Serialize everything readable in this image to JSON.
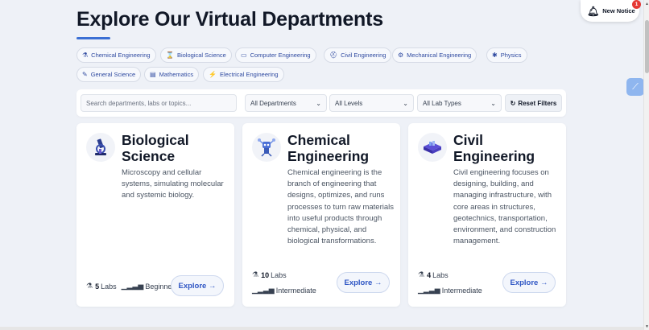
{
  "header": {
    "title": "Explore Our Virtual Departments"
  },
  "chips": [
    {
      "icon": "flask-icon",
      "glyph": "⚗",
      "label": "Chemical Engineering"
    },
    {
      "icon": "dna-icon",
      "glyph": "⌛",
      "label": "Biological Science"
    },
    {
      "icon": "laptop-icon",
      "glyph": "▭",
      "label": "Computer Engineering"
    },
    {
      "icon": "hardhat-icon",
      "glyph": "⛑",
      "label": "Civil Engineering"
    },
    {
      "icon": "gears-icon",
      "glyph": "⚙",
      "label": "Mechanical Engineering"
    },
    {
      "icon": "atom-icon",
      "glyph": "✱",
      "label": "Physics"
    },
    {
      "icon": "pen-icon",
      "glyph": "✎",
      "label": "General Science"
    },
    {
      "icon": "calculator-icon",
      "glyph": "▤",
      "label": "Mathematics"
    },
    {
      "icon": "bolt-icon",
      "glyph": "⚡",
      "label": "Electrical Engineering"
    }
  ],
  "filters": {
    "search_placeholder": "Search departments, labs or topics...",
    "department": "All Departments",
    "level": "All Levels",
    "lab_type": "All Lab Types",
    "reset_label": "Reset Filters"
  },
  "cards": [
    {
      "title": "Biological Science",
      "description": "Microscopy and cellular systems, simulating molecular and systemic biology.",
      "labs_count": "5",
      "labs_label": "Labs",
      "level": "Beginner",
      "explore_label": "Explore →"
    },
    {
      "title": "Chemical Engineering",
      "description": "Chemical engineering is the branch of engineering that designs, optimizes, and runs processes to turn raw materials into useful products through chemical, physical, and biological transformations.",
      "labs_count": "10",
      "labs_label": "Labs",
      "level": "Intermediate",
      "explore_label": "Explore →"
    },
    {
      "title": "Civil Engineering",
      "description": "Civil engineering focuses on designing, building, and managing infrastructure, with core areas in structures, geotechnics, transportation, environment, and construction management.",
      "labs_count": "4",
      "labs_label": "Labs",
      "level": "Intermediate",
      "explore_label": "Explore →"
    }
  ],
  "notice": {
    "label": "New Notice",
    "count": "1"
  },
  "colors": {
    "accent": "#2f56c4",
    "background": "#eef1f7",
    "badge": "#e53935"
  }
}
